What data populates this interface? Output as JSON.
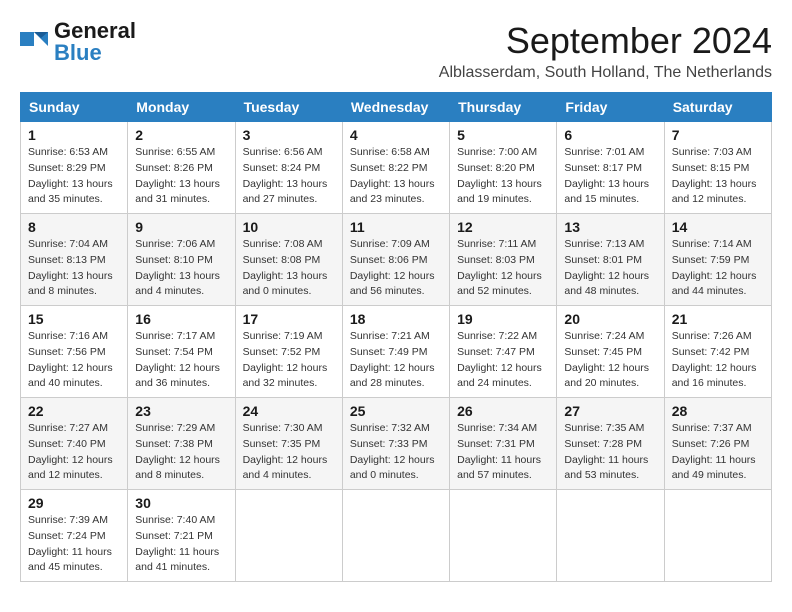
{
  "header": {
    "logo_general": "General",
    "logo_blue": "Blue",
    "month_title": "September 2024",
    "location": "Alblasserdam, South Holland, The Netherlands"
  },
  "days_of_week": [
    "Sunday",
    "Monday",
    "Tuesday",
    "Wednesday",
    "Thursday",
    "Friday",
    "Saturday"
  ],
  "weeks": [
    [
      {
        "day": "1",
        "info": "Sunrise: 6:53 AM\nSunset: 8:29 PM\nDaylight: 13 hours\nand 35 minutes."
      },
      {
        "day": "2",
        "info": "Sunrise: 6:55 AM\nSunset: 8:26 PM\nDaylight: 13 hours\nand 31 minutes."
      },
      {
        "day": "3",
        "info": "Sunrise: 6:56 AM\nSunset: 8:24 PM\nDaylight: 13 hours\nand 27 minutes."
      },
      {
        "day": "4",
        "info": "Sunrise: 6:58 AM\nSunset: 8:22 PM\nDaylight: 13 hours\nand 23 minutes."
      },
      {
        "day": "5",
        "info": "Sunrise: 7:00 AM\nSunset: 8:20 PM\nDaylight: 13 hours\nand 19 minutes."
      },
      {
        "day": "6",
        "info": "Sunrise: 7:01 AM\nSunset: 8:17 PM\nDaylight: 13 hours\nand 15 minutes."
      },
      {
        "day": "7",
        "info": "Sunrise: 7:03 AM\nSunset: 8:15 PM\nDaylight: 13 hours\nand 12 minutes."
      }
    ],
    [
      {
        "day": "8",
        "info": "Sunrise: 7:04 AM\nSunset: 8:13 PM\nDaylight: 13 hours\nand 8 minutes."
      },
      {
        "day": "9",
        "info": "Sunrise: 7:06 AM\nSunset: 8:10 PM\nDaylight: 13 hours\nand 4 minutes."
      },
      {
        "day": "10",
        "info": "Sunrise: 7:08 AM\nSunset: 8:08 PM\nDaylight: 13 hours\nand 0 minutes."
      },
      {
        "day": "11",
        "info": "Sunrise: 7:09 AM\nSunset: 8:06 PM\nDaylight: 12 hours\nand 56 minutes."
      },
      {
        "day": "12",
        "info": "Sunrise: 7:11 AM\nSunset: 8:03 PM\nDaylight: 12 hours\nand 52 minutes."
      },
      {
        "day": "13",
        "info": "Sunrise: 7:13 AM\nSunset: 8:01 PM\nDaylight: 12 hours\nand 48 minutes."
      },
      {
        "day": "14",
        "info": "Sunrise: 7:14 AM\nSunset: 7:59 PM\nDaylight: 12 hours\nand 44 minutes."
      }
    ],
    [
      {
        "day": "15",
        "info": "Sunrise: 7:16 AM\nSunset: 7:56 PM\nDaylight: 12 hours\nand 40 minutes."
      },
      {
        "day": "16",
        "info": "Sunrise: 7:17 AM\nSunset: 7:54 PM\nDaylight: 12 hours\nand 36 minutes."
      },
      {
        "day": "17",
        "info": "Sunrise: 7:19 AM\nSunset: 7:52 PM\nDaylight: 12 hours\nand 32 minutes."
      },
      {
        "day": "18",
        "info": "Sunrise: 7:21 AM\nSunset: 7:49 PM\nDaylight: 12 hours\nand 28 minutes."
      },
      {
        "day": "19",
        "info": "Sunrise: 7:22 AM\nSunset: 7:47 PM\nDaylight: 12 hours\nand 24 minutes."
      },
      {
        "day": "20",
        "info": "Sunrise: 7:24 AM\nSunset: 7:45 PM\nDaylight: 12 hours\nand 20 minutes."
      },
      {
        "day": "21",
        "info": "Sunrise: 7:26 AM\nSunset: 7:42 PM\nDaylight: 12 hours\nand 16 minutes."
      }
    ],
    [
      {
        "day": "22",
        "info": "Sunrise: 7:27 AM\nSunset: 7:40 PM\nDaylight: 12 hours\nand 12 minutes."
      },
      {
        "day": "23",
        "info": "Sunrise: 7:29 AM\nSunset: 7:38 PM\nDaylight: 12 hours\nand 8 minutes."
      },
      {
        "day": "24",
        "info": "Sunrise: 7:30 AM\nSunset: 7:35 PM\nDaylight: 12 hours\nand 4 minutes."
      },
      {
        "day": "25",
        "info": "Sunrise: 7:32 AM\nSunset: 7:33 PM\nDaylight: 12 hours\nand 0 minutes."
      },
      {
        "day": "26",
        "info": "Sunrise: 7:34 AM\nSunset: 7:31 PM\nDaylight: 11 hours\nand 57 minutes."
      },
      {
        "day": "27",
        "info": "Sunrise: 7:35 AM\nSunset: 7:28 PM\nDaylight: 11 hours\nand 53 minutes."
      },
      {
        "day": "28",
        "info": "Sunrise: 7:37 AM\nSunset: 7:26 PM\nDaylight: 11 hours\nand 49 minutes."
      }
    ],
    [
      {
        "day": "29",
        "info": "Sunrise: 7:39 AM\nSunset: 7:24 PM\nDaylight: 11 hours\nand 45 minutes."
      },
      {
        "day": "30",
        "info": "Sunrise: 7:40 AM\nSunset: 7:21 PM\nDaylight: 11 hours\nand 41 minutes."
      },
      {
        "day": "",
        "info": ""
      },
      {
        "day": "",
        "info": ""
      },
      {
        "day": "",
        "info": ""
      },
      {
        "day": "",
        "info": ""
      },
      {
        "day": "",
        "info": ""
      }
    ]
  ]
}
